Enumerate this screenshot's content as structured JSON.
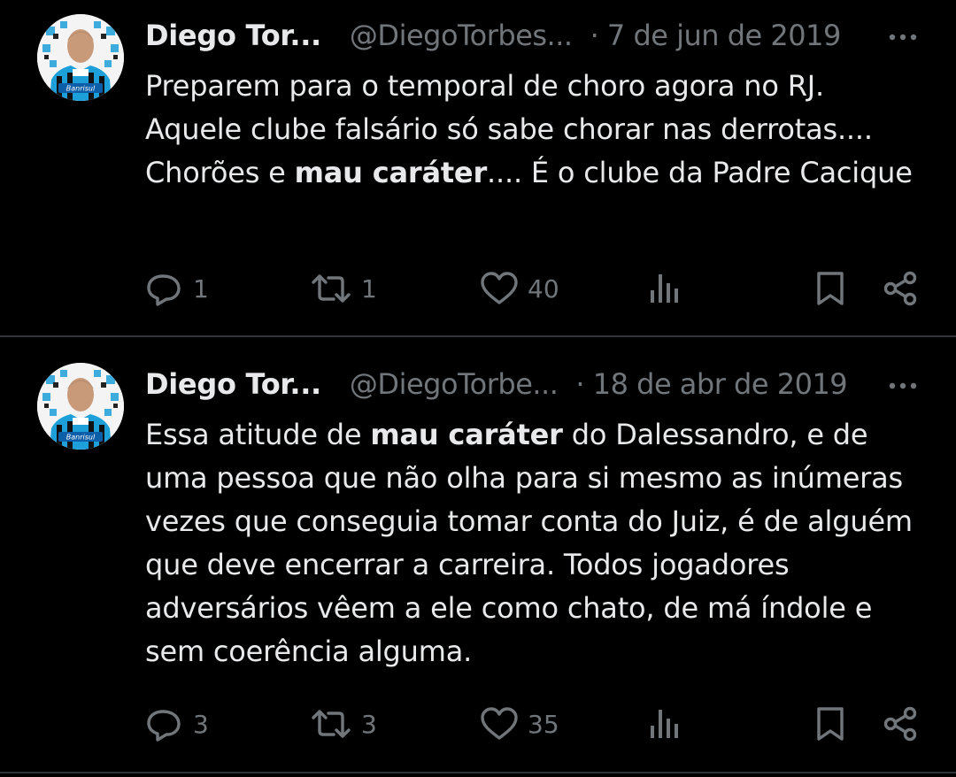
{
  "tweets": [
    {
      "author_name": "Diego Tor...",
      "handle": "@DiegoTorbes...",
      "date": "· 7 de jun de 2019",
      "text_parts": [
        "Preparem para o temporal de choro agora no RJ. Aquele clube falsário só sabe chorar nas derrotas.... Chorões e ",
        "mau caráter",
        ".... É o clube da Padre Cacique"
      ],
      "replies": "1",
      "retweets": "1",
      "likes": "40"
    },
    {
      "author_name": "Diego Tor...",
      "handle": "@DiegoTorbe...",
      "date": "· 18 de abr de 2019",
      "text_parts": [
        "Essa atitude de ",
        "mau caráter",
        " do Dalessandro, e de uma pessoa que não olha para si mesmo as inúmeras vezes que conseguia tomar conta do Juiz, é de alguém que deve encerrar a carreira. Todos jogadores adversários vêem a ele como chato, de má índole e sem coerência alguma."
      ],
      "replies": "3",
      "retweets": "3",
      "likes": "35"
    }
  ],
  "avatar_badge_text": "Banrisul",
  "icons": {
    "reply": "reply-icon",
    "retweet": "retweet-icon",
    "like": "heart-icon",
    "views": "views-icon",
    "bookmark": "bookmark-icon",
    "share": "share-icon",
    "more": "more-icon"
  },
  "colors": {
    "background": "#000000",
    "text": "#e7e9ea",
    "secondary": "#71767b",
    "divider": "#2f3336",
    "avatar_jersey": "#1d9fd9"
  }
}
